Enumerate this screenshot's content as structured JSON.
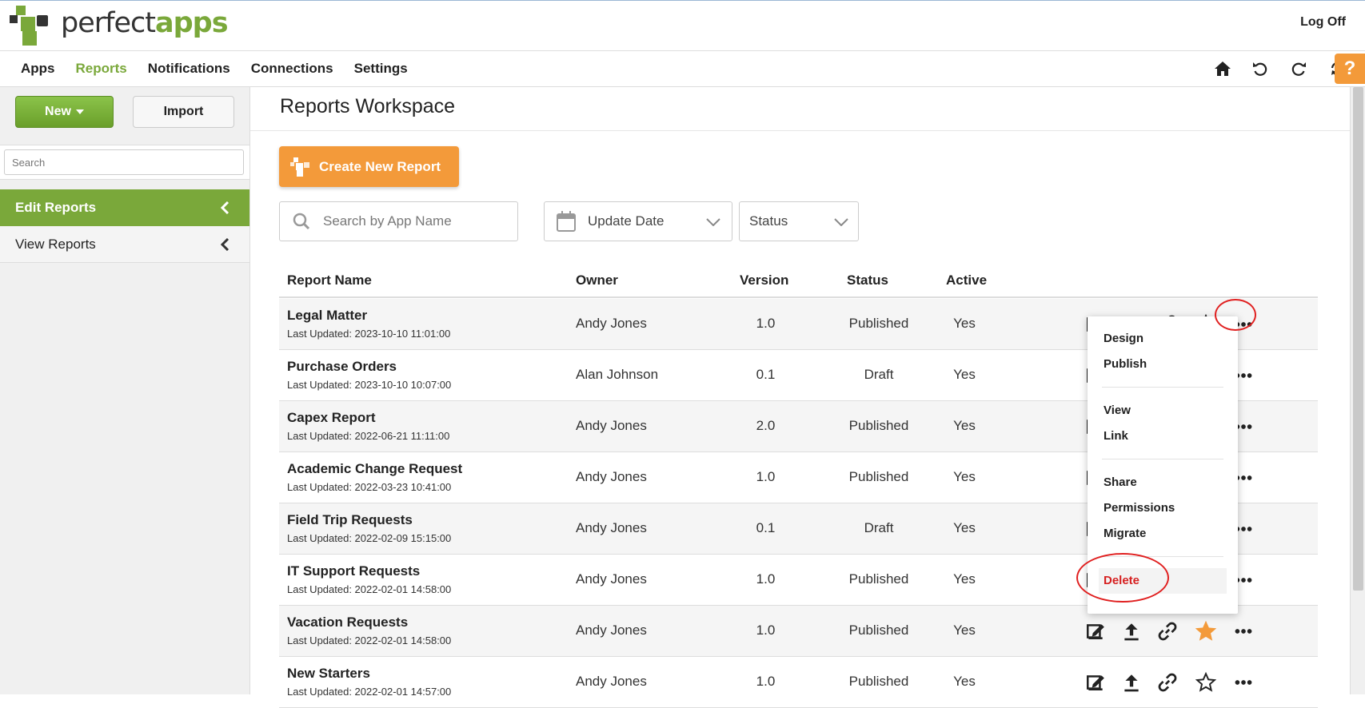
{
  "header": {
    "logo_text_a": "perfect",
    "logo_text_b": "apps",
    "logoff": "Log Off"
  },
  "nav": {
    "items": [
      {
        "label": "Apps"
      },
      {
        "label": "Reports"
      },
      {
        "label": "Notifications"
      },
      {
        "label": "Connections"
      },
      {
        "label": "Settings"
      }
    ],
    "help": "?"
  },
  "sidebar": {
    "new_label": "New",
    "import_label": "Import",
    "search_placeholder": "Search",
    "items": [
      {
        "label": "Edit Reports"
      },
      {
        "label": "View Reports"
      }
    ]
  },
  "main": {
    "title": "Reports Workspace",
    "create_label": "Create New Report",
    "search_placeholder": "Search by App Name",
    "date_filter": "Update Date",
    "status_filter": "Status",
    "columns": {
      "name": "Report Name",
      "owner": "Owner",
      "version": "Version",
      "status": "Status",
      "active": "Active"
    },
    "rows": [
      {
        "name": "Legal Matter",
        "updated": "Last Updated: 2023-10-10 11:01:00",
        "owner": "Andy Jones",
        "version": "1.0",
        "status": "Published",
        "active": "Yes",
        "favorite": false
      },
      {
        "name": "Purchase Orders",
        "updated": "Last Updated: 2023-10-10 10:07:00",
        "owner": "Alan Johnson",
        "version": "0.1",
        "status": "Draft",
        "active": "Yes",
        "favorite": false
      },
      {
        "name": "Capex Report",
        "updated": "Last Updated: 2022-06-21 11:11:00",
        "owner": "Andy Jones",
        "version": "2.0",
        "status": "Published",
        "active": "Yes",
        "favorite": false
      },
      {
        "name": "Academic Change Request",
        "updated": "Last Updated: 2022-03-23 10:41:00",
        "owner": "Andy Jones",
        "version": "1.0",
        "status": "Published",
        "active": "Yes",
        "favorite": false
      },
      {
        "name": "Field Trip Requests",
        "updated": "Last Updated: 2022-02-09 15:15:00",
        "owner": "Andy Jones",
        "version": "0.1",
        "status": "Draft",
        "active": "Yes",
        "favorite": false
      },
      {
        "name": "IT Support Requests",
        "updated": "Last Updated: 2022-02-01 14:58:00",
        "owner": "Andy Jones",
        "version": "1.0",
        "status": "Published",
        "active": "Yes",
        "favorite": false
      },
      {
        "name": "Vacation Requests",
        "updated": "Last Updated: 2022-02-01 14:58:00",
        "owner": "Andy Jones",
        "version": "1.0",
        "status": "Published",
        "active": "Yes",
        "favorite": true
      },
      {
        "name": "New Starters",
        "updated": "Last Updated: 2022-02-01 14:57:00",
        "owner": "Andy Jones",
        "version": "1.0",
        "status": "Published",
        "active": "Yes",
        "favorite": false
      }
    ]
  },
  "context_menu": {
    "design": "Design",
    "publish": "Publish",
    "view": "View",
    "link": "Link",
    "share": "Share",
    "permissions": "Permissions",
    "migrate": "Migrate",
    "delete": "Delete"
  },
  "colors": {
    "brand_green": "#7aa83a",
    "accent_orange": "#f39a3a",
    "delete_red": "#d62020",
    "highlight_circle": "#e02020"
  }
}
